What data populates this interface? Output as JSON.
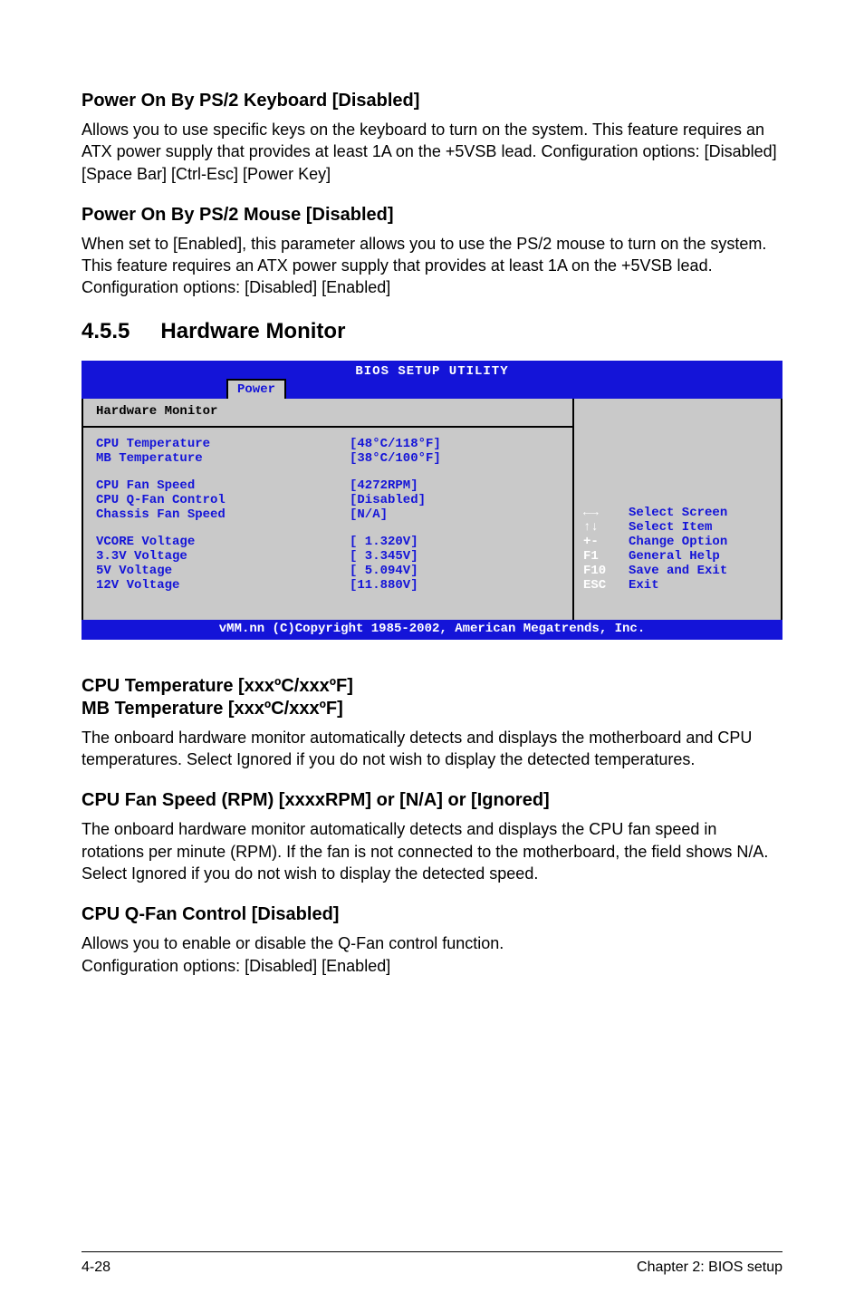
{
  "s1": {
    "h": "Power On By PS/2 Keyboard [Disabled]",
    "p": "Allows you to use specific keys on the keyboard to turn on the system. This feature requires an ATX power supply that provides at least 1A on the +5VSB lead. Configuration options: [Disabled] [Space Bar] [Ctrl-Esc] [Power Key]"
  },
  "s2": {
    "h": "Power On By PS/2 Mouse [Disabled]",
    "p": "When set to [Enabled], this parameter allows you to use the PS/2 mouse to turn on the system. This feature requires an ATX power supply that provides at least 1A on the +5VSB lead. Configuration options: [Disabled] [Enabled]"
  },
  "section": {
    "num": "4.5.5",
    "title": "Hardware Monitor"
  },
  "bios": {
    "title": "BIOS SETUP UTILITY",
    "tab": "Power",
    "panel_title": "Hardware Monitor",
    "rows": {
      "r1l": "CPU Temperature",
      "r1v": "[48°C/118°F]",
      "r2l": "MB Temperature",
      "r2v": "[38°C/100°F]",
      "r3l": "CPU Fan Speed",
      "r3v": "[4272RPM]",
      "r4l": "CPU Q-Fan Control",
      "r4v": "[Disabled]",
      "r5l": "Chassis Fan Speed",
      "r5v": "[N/A]",
      "r6l": "VCORE Voltage",
      "r6v": "[ 1.320V]",
      "r7l": "3.3V Voltage",
      "r7v": "[ 3.345V]",
      "r8l": "5V Voltage",
      "r8v": "[ 5.094V]",
      "r9l": "12V Voltage",
      "r9v": "[11.880V]"
    },
    "help": {
      "k1": "←→",
      "t1": "Select Screen",
      "k2": "↑↓",
      "t2": "Select Item",
      "k3": "+-",
      "t3": "Change Option",
      "k4": "F1",
      "t4": "General Help",
      "k5": "F10",
      "t5": "Save and Exit",
      "k6": "ESC",
      "t6": "Exit"
    },
    "footer": "vMM.nn (C)Copyright 1985-2002, American Megatrends, Inc."
  },
  "s3": {
    "h1": "CPU Temperature [xxxºC/xxxºF]",
    "h2": "MB Temperature [xxxºC/xxxºF]",
    "p": "The onboard hardware monitor automatically detects and displays the motherboard and CPU temperatures. Select Ignored if you do not wish to display the detected temperatures."
  },
  "s4": {
    "h": "CPU Fan Speed (RPM) [xxxxRPM] or [N/A] or [Ignored]",
    "p": "The onboard hardware monitor automatically detects and displays the CPU fan speed in rotations per minute (RPM). If the fan is not connected to the motherboard, the field shows N/A. Select Ignored if you do not wish to display the detected speed."
  },
  "s5": {
    "h": "CPU Q-Fan Control [Disabled]",
    "p1": "Allows you to enable or disable the Q-Fan control function.",
    "p2": "Configuration options: [Disabled] [Enabled]"
  },
  "footer": {
    "left": "4-28",
    "right": "Chapter 2: BIOS setup"
  }
}
